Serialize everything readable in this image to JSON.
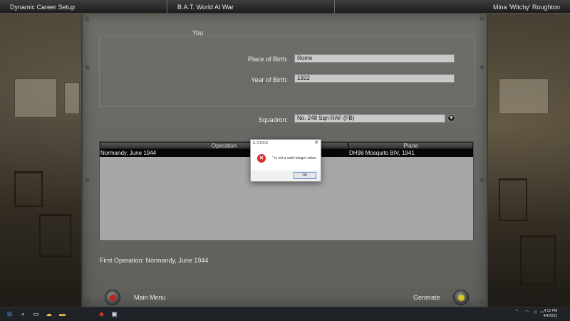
{
  "topbar": {
    "left_title": "Dynamic Career Setup",
    "center_title": "B.A.T. World At War",
    "right_title": "Mina 'Witchy' Roughton"
  },
  "profile": {
    "section_label": "You",
    "place_of_birth_label": "Place of Birth:",
    "place_of_birth_value": "Rome",
    "year_of_birth_label": "Year of Birth:",
    "year_of_birth_value": "1922",
    "squadron_label": "Squadron:",
    "squadron_value": "No. 248 Sqn RAF (FB)"
  },
  "table": {
    "columns": [
      "Operation",
      "Plane"
    ],
    "rows": [
      {
        "operation": "Normandy, June 1944",
        "plane": "DH98 Mosquito BIV, 1941"
      }
    ]
  },
  "first_operation": "First Operation: Normandy, June 1944",
  "buttons": {
    "main_menu": "Main Menu",
    "generate": "Generate"
  },
  "dialog": {
    "title": "IL-2 DCG",
    "message": "'' is not a valid integer value.",
    "ok_label": "OK"
  },
  "taskbar": {
    "time": "4:12 PM",
    "date": "4/4/2022"
  }
}
